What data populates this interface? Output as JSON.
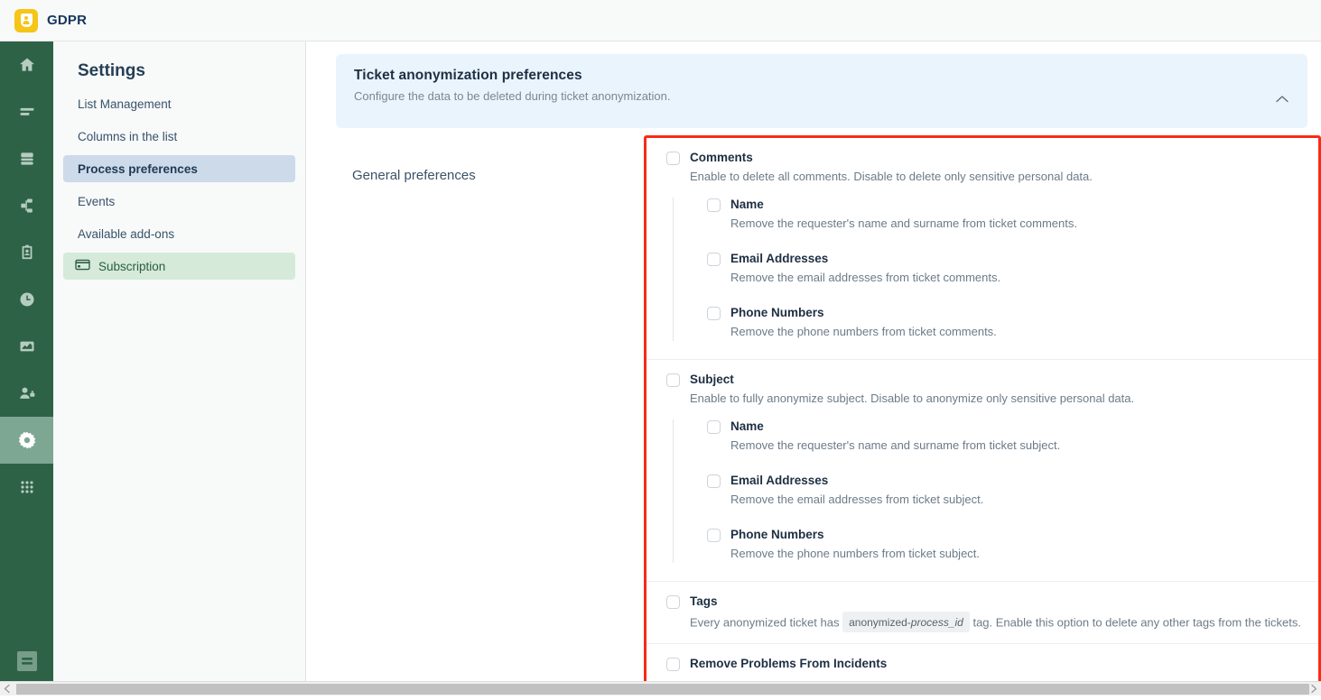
{
  "app": {
    "brand": "GDPR",
    "logo_color": "#f5c518",
    "rail_color": "#2e6246"
  },
  "rail": {
    "items": [
      {
        "name": "home-icon",
        "label": "Home"
      },
      {
        "name": "lists-icon",
        "label": "Lists"
      },
      {
        "name": "database-icon",
        "label": "Database"
      },
      {
        "name": "workflow-icon",
        "label": "Workflow"
      },
      {
        "name": "clipboard-icon",
        "label": "Requests"
      },
      {
        "name": "clock-icon",
        "label": "History"
      },
      {
        "name": "chart-icon",
        "label": "Reports"
      },
      {
        "name": "user-lock-icon",
        "label": "Users"
      },
      {
        "name": "gear-icon",
        "label": "Settings"
      },
      {
        "name": "grid-apps-icon",
        "label": "Apps"
      }
    ],
    "active_index": 8,
    "bottom_item": {
      "name": "collapse-menu-icon",
      "label": "Collapse menu"
    }
  },
  "settings": {
    "title": "Settings",
    "items": [
      {
        "label": "List Management",
        "state": "normal"
      },
      {
        "label": "Columns in the list",
        "state": "normal"
      },
      {
        "label": "Process preferences",
        "state": "active-blue"
      },
      {
        "label": "Events",
        "state": "normal"
      },
      {
        "label": "Available add-ons",
        "state": "normal"
      },
      {
        "label": "Subscription",
        "state": "active-green",
        "icon": "credit-card-icon"
      }
    ]
  },
  "panel": {
    "title": "Ticket anonymization preferences",
    "subtitle": "Configure the data to be deleted during ticket anonymization.",
    "collapse_icon": "chevron-up-icon",
    "background": "#eaf4fd"
  },
  "section_label": "General preferences",
  "highlight": {
    "border_color": "#f92b16"
  },
  "options": [
    {
      "title": "Comments",
      "desc": "Enable to delete all comments. Disable to delete only sensitive personal data.",
      "checked": false,
      "children": [
        {
          "title": "Name",
          "desc": "Remove the requester's name and surname from ticket comments.",
          "checked": false
        },
        {
          "title": "Email Addresses",
          "desc": "Remove the email addresses from ticket comments.",
          "checked": false
        },
        {
          "title": "Phone Numbers",
          "desc": "Remove the phone numbers from ticket comments.",
          "checked": false
        }
      ]
    },
    {
      "title": "Subject",
      "desc": "Enable to fully anonymize subject. Disable to anonymize only sensitive personal data.",
      "checked": false,
      "children": [
        {
          "title": "Name",
          "desc": "Remove the requester's name and surname from ticket subject.",
          "checked": false
        },
        {
          "title": "Email Addresses",
          "desc": "Remove the email addresses from ticket subject.",
          "checked": false
        },
        {
          "title": "Phone Numbers",
          "desc": "Remove the phone numbers from ticket subject.",
          "checked": false
        }
      ]
    },
    {
      "title": "Tags",
      "desc_before": "Every anonymized ticket has",
      "desc_chip_plain": "anonymized-",
      "desc_chip_italic": "process_id",
      "desc_after": "tag. Enable this option to delete any other tags from the tickets.",
      "checked": false,
      "children": []
    },
    {
      "title": "Remove Problems From Incidents",
      "desc": "",
      "checked": false,
      "children": []
    }
  ],
  "scrollbar": {
    "orientation": "horizontal",
    "left_arrow": "scroll-left-arrow",
    "right_arrow": "scroll-right-arrow"
  }
}
